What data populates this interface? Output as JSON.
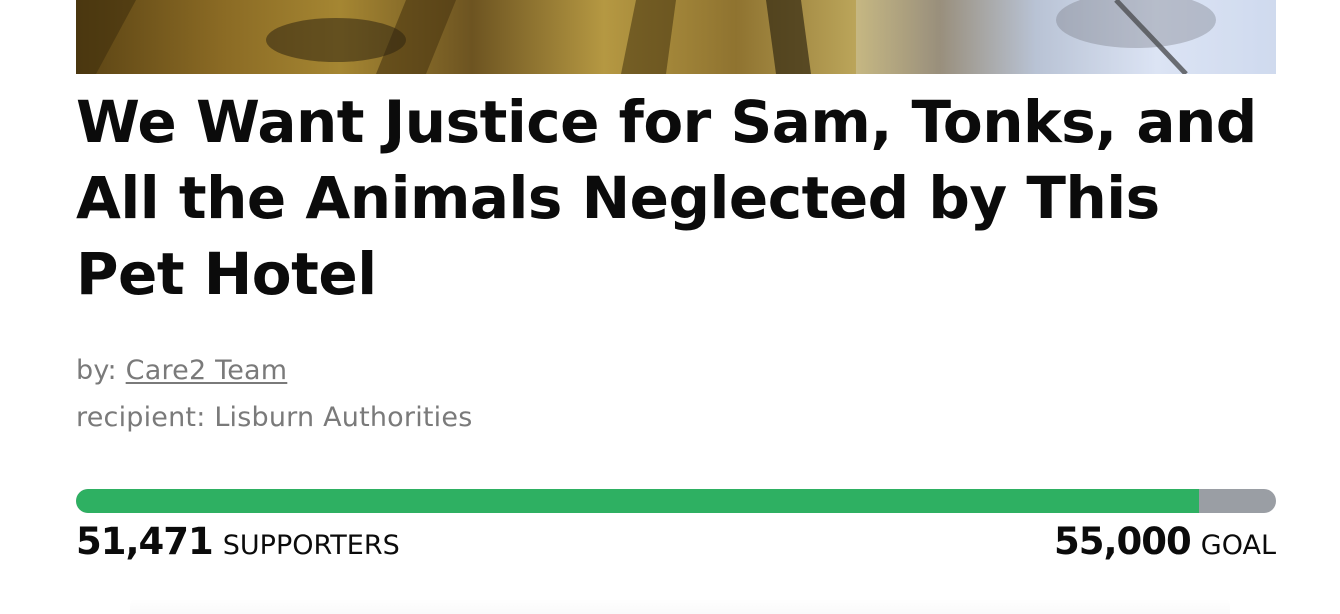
{
  "petition": {
    "title": "We Want Justice for Sam, Tonks, and All the Animals Neglected by This Pet Hotel",
    "author_prefix": "by:",
    "author_name": "Care2 Team",
    "recipient_prefix": "recipient:",
    "recipient_name": "Lisburn Authorities"
  },
  "progress": {
    "supporters": "51,471",
    "supporters_label": "SUPPORTERS",
    "goal": "55,000",
    "goal_label": "GOAL",
    "fraction": 0.9358,
    "fill_color": "#2eb062",
    "track_color": "#9a9ea4"
  }
}
